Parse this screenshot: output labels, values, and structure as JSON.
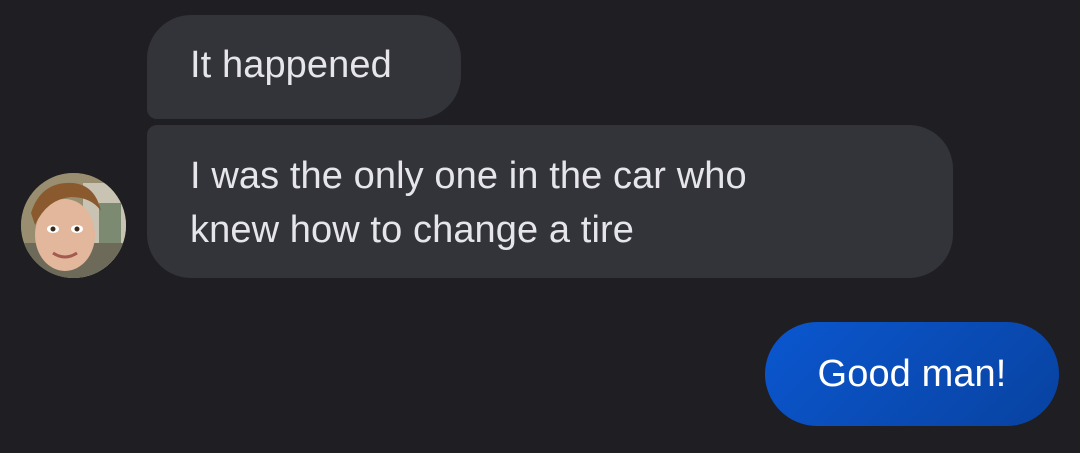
{
  "conversation": {
    "incoming": [
      {
        "lines": [
          "It happened"
        ]
      },
      {
        "lines": [
          "I was the only one in the car who",
          "knew how to change a tire"
        ]
      }
    ],
    "outgoing": [
      {
        "lines": [
          "Good man!"
        ]
      }
    ]
  },
  "contact": {
    "avatar_icon": "user-photo-avatar"
  },
  "colors": {
    "background": "#1f1f23",
    "incoming_bubble": "#33343a",
    "outgoing_bubble": "#0b57d0",
    "text": "#e6e6ea"
  }
}
